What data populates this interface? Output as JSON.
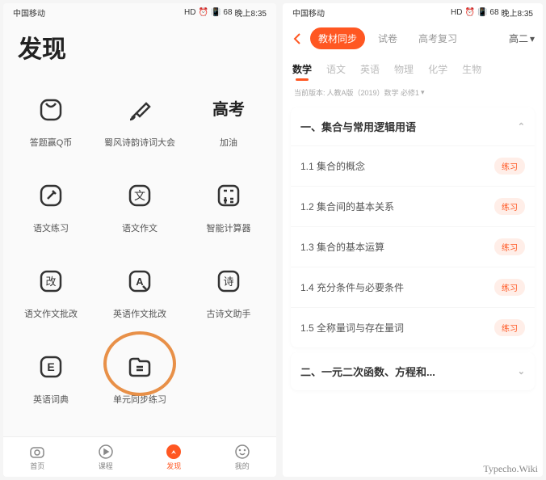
{
  "status": {
    "carrier": "中国移动",
    "icons": "HD",
    "battery": "68",
    "time": "晚上8:35"
  },
  "left": {
    "title": "发现",
    "cells": [
      {
        "label": "答题赢Q币"
      },
      {
        "label": "蜀风诗韵诗词大会"
      },
      {
        "label": "加油",
        "heading": "高考"
      },
      {
        "label": "语文练习"
      },
      {
        "label": "语文作文"
      },
      {
        "label": "智能计算器"
      },
      {
        "label": "语文作文批改"
      },
      {
        "label": "英语作文批改"
      },
      {
        "label": "古诗文助手"
      },
      {
        "label": "英语词典"
      },
      {
        "label": "单元同步练习"
      }
    ],
    "nav": [
      {
        "label": "首页"
      },
      {
        "label": "课程"
      },
      {
        "label": "发现"
      },
      {
        "label": "我的"
      }
    ]
  },
  "right": {
    "tabs": [
      {
        "label": "教材同步",
        "active": true
      },
      {
        "label": "试卷"
      },
      {
        "label": "高考复习"
      }
    ],
    "grade": "高二",
    "subjects": [
      {
        "label": "数学",
        "active": true
      },
      {
        "label": "语文"
      },
      {
        "label": "英语"
      },
      {
        "label": "物理"
      },
      {
        "label": "化学"
      },
      {
        "label": "生物"
      }
    ],
    "version_prefix": "当前版本:",
    "version": "人教A版（2019）数学 必修1",
    "chapter1": {
      "title": "一、集合与常用逻辑用语",
      "practice": "练习",
      "sections": [
        "1.1 集合的概念",
        "1.2 集合间的基本关系",
        "1.3 集合的基本运算",
        "1.4 充分条件与必要条件",
        "1.5 全称量词与存在量词"
      ]
    },
    "chapter2": {
      "title": "二、一元二次函数、方程和..."
    }
  },
  "watermark": "Typecho.Wiki"
}
